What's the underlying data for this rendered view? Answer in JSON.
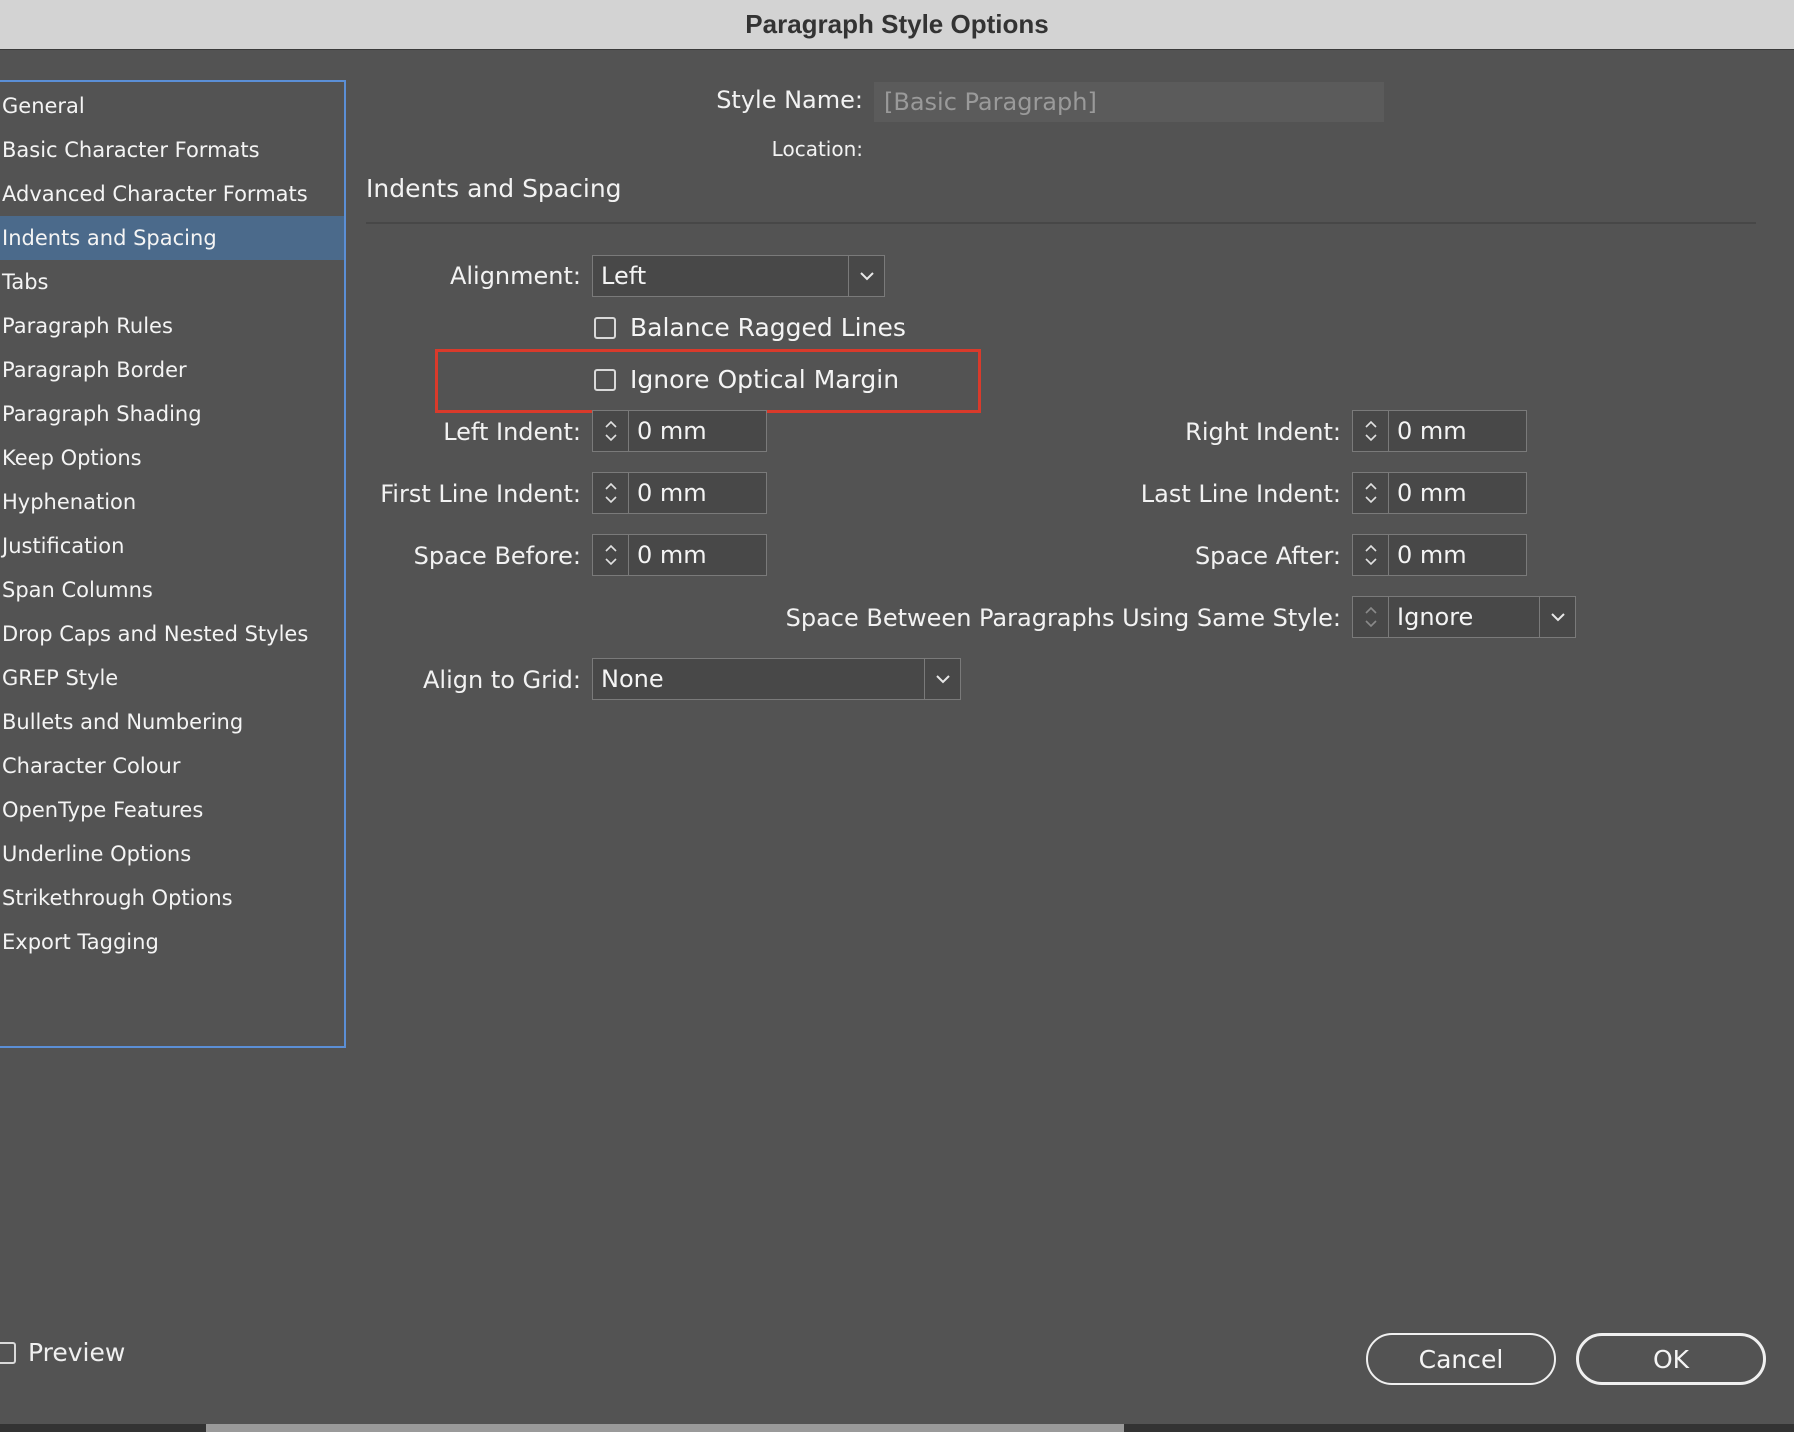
{
  "window": {
    "title": "Paragraph Style Options"
  },
  "sidebar": {
    "items": [
      {
        "label": "General"
      },
      {
        "label": "Basic Character Formats"
      },
      {
        "label": "Advanced Character Formats"
      },
      {
        "label": "Indents and Spacing",
        "selected": true
      },
      {
        "label": "Tabs"
      },
      {
        "label": "Paragraph Rules"
      },
      {
        "label": "Paragraph Border"
      },
      {
        "label": "Paragraph Shading"
      },
      {
        "label": "Keep Options"
      },
      {
        "label": "Hyphenation"
      },
      {
        "label": "Justification"
      },
      {
        "label": "Span Columns"
      },
      {
        "label": "Drop Caps and Nested Styles"
      },
      {
        "label": "GREP Style"
      },
      {
        "label": "Bullets and Numbering"
      },
      {
        "label": "Character Colour"
      },
      {
        "label": "OpenType Features"
      },
      {
        "label": "Underline Options"
      },
      {
        "label": "Strikethrough Options"
      },
      {
        "label": "Export Tagging"
      }
    ]
  },
  "header": {
    "style_name_label": "Style Name:",
    "style_name_value": "[Basic Paragraph]",
    "location_label": "Location:"
  },
  "section": {
    "title": "Indents and Spacing"
  },
  "form": {
    "alignment_label": "Alignment:",
    "alignment_value": "Left",
    "balance_ragged_label": "Balance Ragged Lines",
    "balance_ragged_checked": false,
    "ignore_optical_label": "Ignore Optical Margin",
    "ignore_optical_checked": false,
    "left_indent_label": "Left Indent:",
    "left_indent_value": "0 mm",
    "first_line_label": "First Line Indent:",
    "first_line_value": "0 mm",
    "space_before_label": "Space Before:",
    "space_before_value": "0 mm",
    "right_indent_label": "Right Indent:",
    "right_indent_value": "0 mm",
    "last_line_label": "Last Line Indent:",
    "last_line_value": "0 mm",
    "space_after_label": "Space After:",
    "space_after_value": "0 mm",
    "space_between_label": "Space Between Paragraphs Using Same Style:",
    "space_between_value": "Ignore",
    "align_grid_label": "Align to Grid:",
    "align_grid_value": "None"
  },
  "footer": {
    "preview_label": "Preview",
    "preview_checked": false,
    "cancel_label": "Cancel",
    "ok_label": "OK"
  },
  "colors": {
    "background": "#535353",
    "titlebar": "#d3d3d3",
    "selection": "#4b6a8b",
    "sidebar_border": "#5b8fd6",
    "highlight": "#d93a2b"
  }
}
